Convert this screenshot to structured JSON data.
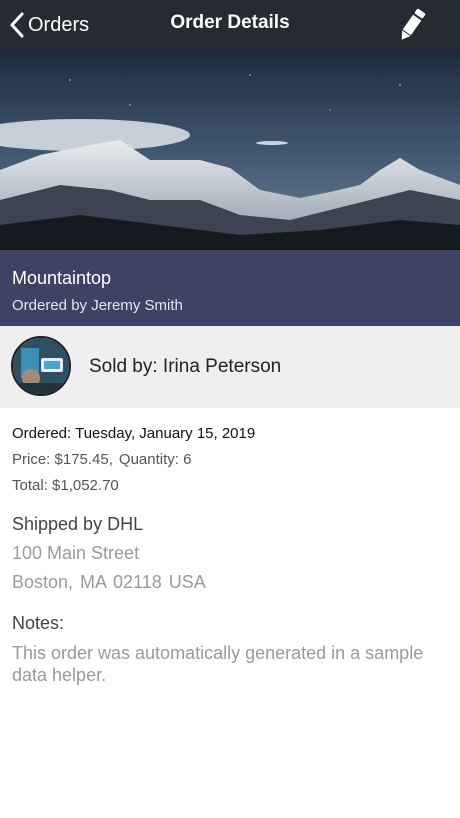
{
  "navbar": {
    "back_label": "Orders",
    "title": "Order Details",
    "edit_icon": "pencil-icon"
  },
  "hero": {
    "image": "mountain-range-photo"
  },
  "product": {
    "name": "Mountaintop",
    "ordered_by": "Ordered by Jeremy Smith"
  },
  "seller": {
    "label": "Sold by: Irina Peterson",
    "avatar": "seller-avatar"
  },
  "order": {
    "ordered": "Ordered: Tuesday, January 15, 2019",
    "price": "Price: $175.45,",
    "quantity": "Quantity: 6",
    "total": "Total: $1,052.70"
  },
  "shipping": {
    "carrier": "Shipped by DHL",
    "address_line1": "100 Main Street",
    "address_line2": "Boston, MA 02118 USA"
  },
  "notes": {
    "label": "Notes:",
    "text": "This order was automatically generated in a sample data helper."
  },
  "colors": {
    "navbar_bg": "#262a33",
    "title_band_bg": "#3e4265",
    "seller_band_bg": "#efefef"
  }
}
